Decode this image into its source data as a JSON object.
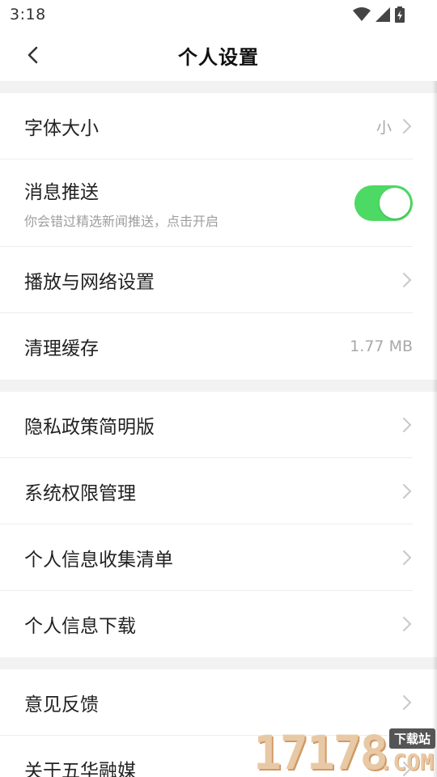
{
  "status_bar": {
    "time": "3:18"
  },
  "header": {
    "title": "个人设置"
  },
  "sections": [
    {
      "rows": [
        {
          "label": "字体大小",
          "value": "小"
        },
        {
          "label": "消息推送",
          "subtitle": "你会错过精选新闻推送，点击开启",
          "toggle_on": true
        },
        {
          "label": "播放与网络设置"
        },
        {
          "label": "清理缓存",
          "value": "1.77 MB"
        }
      ]
    },
    {
      "rows": [
        {
          "label": "隐私政策简明版"
        },
        {
          "label": "系统权限管理"
        },
        {
          "label": "个人信息收集清单"
        },
        {
          "label": "个人信息下载"
        }
      ]
    },
    {
      "rows": [
        {
          "label": "意见反馈"
        },
        {
          "label": "关于五华融媒"
        }
      ]
    }
  ],
  "watermark": {
    "number": "17178",
    "tag": "下载站",
    "suffix": ".COM"
  },
  "colors": {
    "toggle_on": "#4cd964",
    "section_gap": "#f2f2f2",
    "secondary_text": "#9e9e9e"
  }
}
